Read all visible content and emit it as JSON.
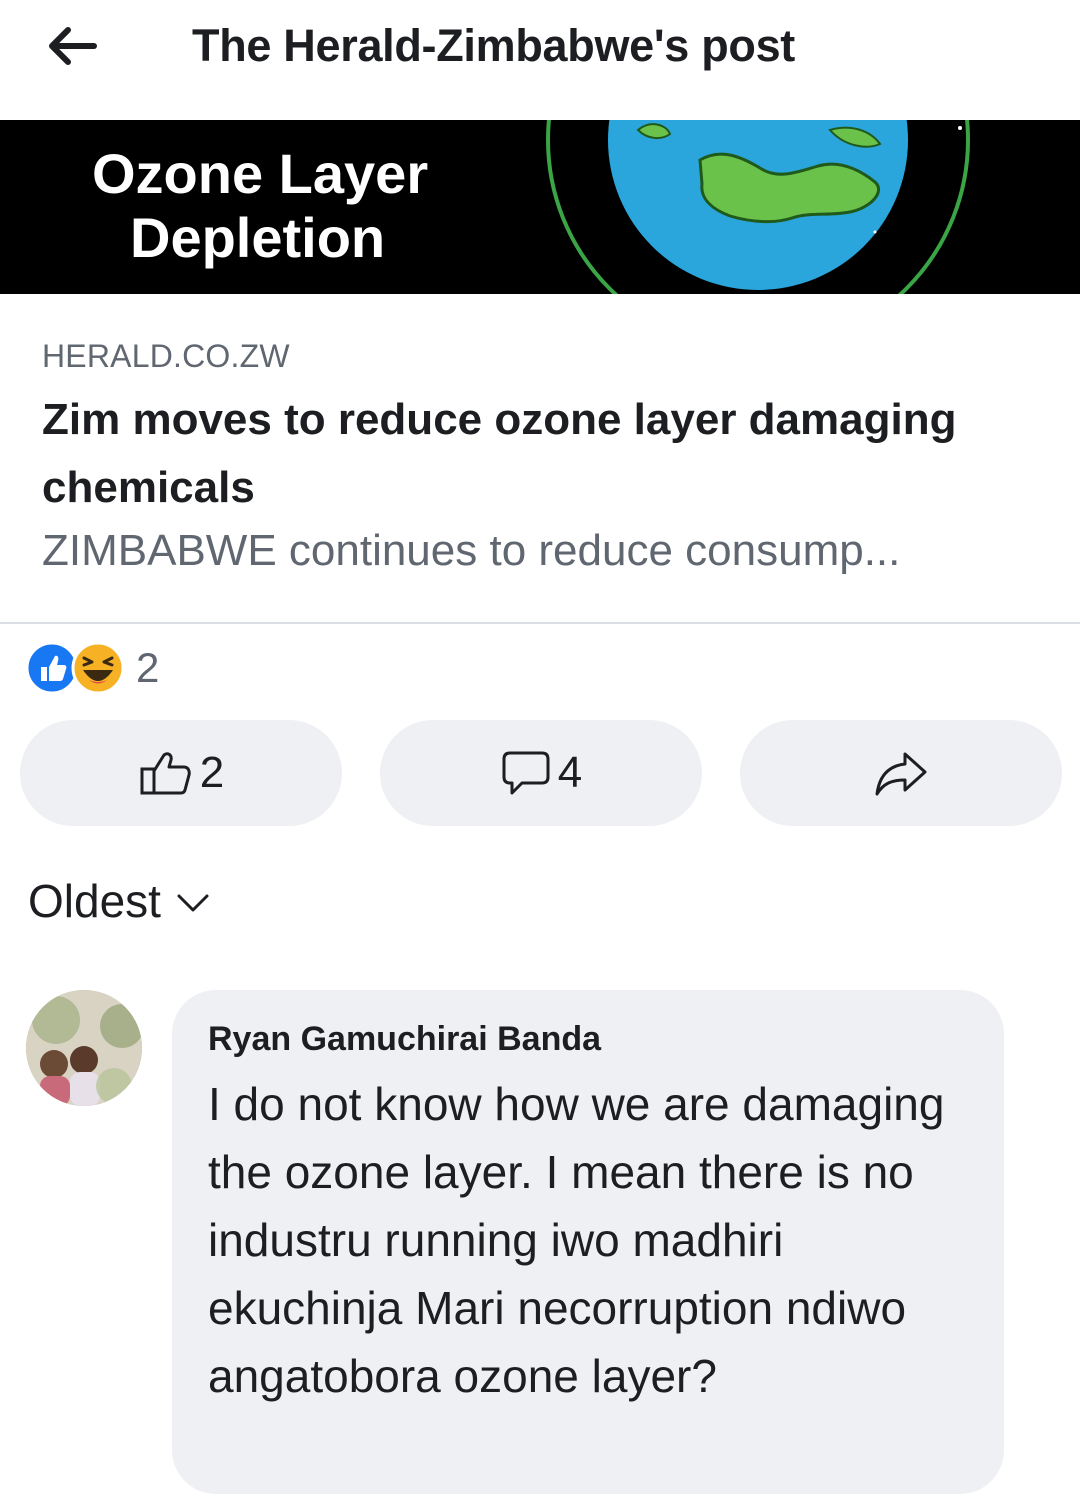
{
  "header": {
    "title": "The Herald-Zimbabwe's post"
  },
  "banner": {
    "line1": "Ozone Layer",
    "line2": "Depletion"
  },
  "link_preview": {
    "domain": "HERALD.CO.ZW",
    "headline": "Zim moves to reduce ozone layer damaging chemicals",
    "snippet": "ZIMBABWE continues to reduce consump..."
  },
  "reactions": {
    "types": [
      "like",
      "haha"
    ],
    "count": "2"
  },
  "actions": {
    "like_count": "2",
    "comment_count": "4"
  },
  "comments": {
    "sort_label": "Oldest",
    "items": [
      {
        "author": "Ryan Gamuchirai Banda",
        "text": "I do not know how we are damaging the ozone layer. I mean there is no industru running iwo madhiri ekuchinja Mari necorruption ndiwo angatobora ozone layer?"
      }
    ]
  },
  "colors": {
    "like_blue": "#1877f2",
    "haha_yellow": "#f7b125",
    "pill_bg": "#eef0f3",
    "secondary_text": "#606770"
  }
}
